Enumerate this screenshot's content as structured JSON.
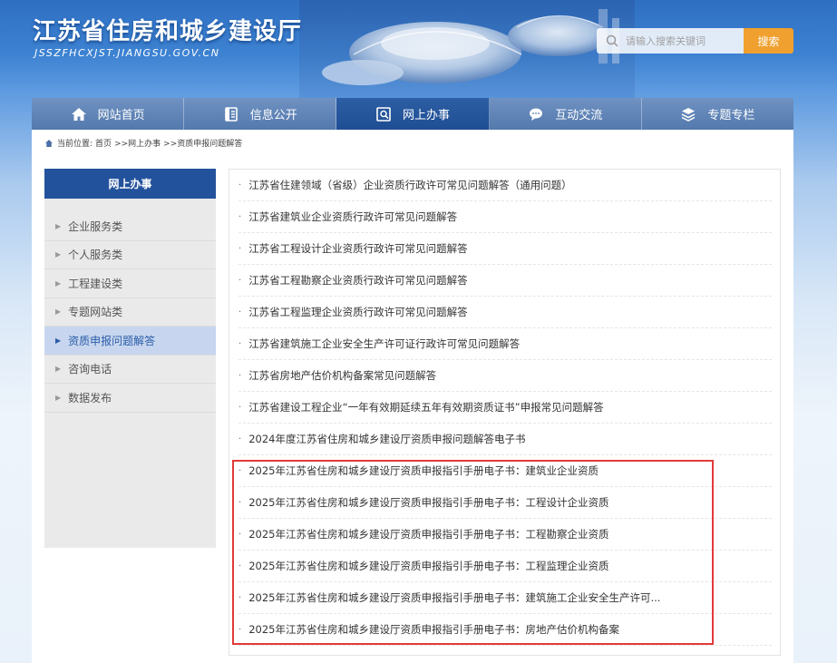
{
  "header": {
    "title": "江苏省住房和城乡建设厅",
    "domain": "JSSZFHCXJST.JIANGSU.GOV.CN"
  },
  "search": {
    "placeholder": "请输入搜索关键词",
    "button_label": "搜索"
  },
  "nav": {
    "items": [
      {
        "label": "网站首页",
        "icon": "home-icon"
      },
      {
        "label": "信息公开",
        "icon": "document-icon"
      },
      {
        "label": "网上办事",
        "icon": "service-icon"
      },
      {
        "label": "互动交流",
        "icon": "chat-icon"
      },
      {
        "label": "专题专栏",
        "icon": "layers-icon"
      }
    ],
    "active_index": 2
  },
  "breadcrumb": {
    "prefix": "当前位置:",
    "home": "首页",
    "level1": ">>网上办事",
    "level2": ">>资质申报问题解答"
  },
  "sidebar": {
    "title": "网上办事",
    "items": [
      {
        "label": "企业服务类"
      },
      {
        "label": "个人服务类"
      },
      {
        "label": "工程建设类"
      },
      {
        "label": "专题网站类"
      },
      {
        "label": "资质申报问题解答"
      },
      {
        "label": "咨询电话"
      },
      {
        "label": "数据发布"
      }
    ],
    "active_index": 4
  },
  "list": {
    "bullet": "·",
    "items": [
      "江苏省住建领域（省级）企业资质行政许可常见问题解答（通用问题）",
      "江苏省建筑业企业资质行政许可常见问题解答",
      "江苏省工程设计企业资质行政许可常见问题解答",
      "江苏省工程勘察企业资质行政许可常见问题解答",
      "江苏省工程监理企业资质行政许可常见问题解答",
      "江苏省建筑施工企业安全生产许可证行政许可常见问题解答",
      "江苏省房地产估价机构备案常见问题解答",
      "江苏省建设工程企业“一年有效期延续五年有效期资质证书”申报常见问题解答",
      "2024年度江苏省住房和城乡建设厅资质申报问题解答电子书",
      "2025年江苏省住房和城乡建设厅资质申报指引手册电子书：建筑业企业资质",
      "2025年江苏省住房和城乡建设厅资质申报指引手册电子书：工程设计企业资质",
      "2025年江苏省住房和城乡建设厅资质申报指引手册电子书：工程勘察企业资质",
      "2025年江苏省住房和城乡建设厅资质申报指引手册电子书：工程监理企业资质",
      "2025年江苏省住房和城乡建设厅资质申报指引手册电子书：建筑施工企业安全生产许可...",
      "2025年江苏省住房和城乡建设厅资质申报指引手册电子书：房地产估价机构备案"
    ]
  },
  "colors": {
    "nav_active": "#1e4d93",
    "sidebar_header": "#23529c",
    "search_button": "#f0a02e",
    "highlight_border": "#e23a3a"
  }
}
